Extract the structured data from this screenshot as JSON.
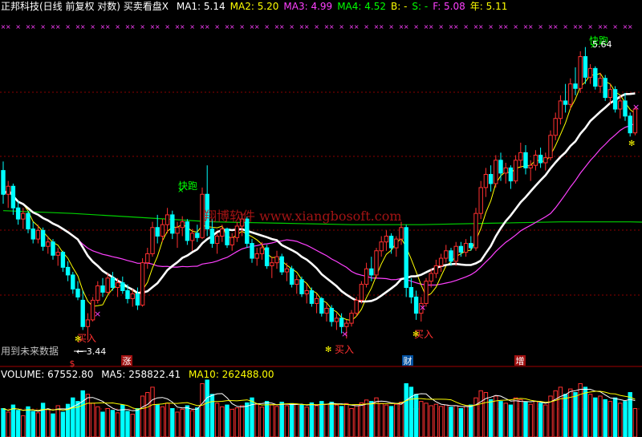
{
  "header": {
    "title": "正邦科技(日线 前复权 对数) 买卖看盘X",
    "indicators": [
      {
        "name": "MA1:",
        "value": "5.14",
        "color": "#ffffff"
      },
      {
        "name": "MA2:",
        "value": "5.20",
        "color": "#ffff00"
      },
      {
        "name": "MA3:",
        "value": "4.99",
        "color": "#ff40ff"
      },
      {
        "name": "MA4:",
        "value": "4.52",
        "color": "#00ff00"
      },
      {
        "name": "B:",
        "value": "-",
        "color": "#ffff00"
      },
      {
        "name": "S:",
        "value": "-",
        "color": "#00ff00"
      },
      {
        "name": "F:",
        "value": "5.08",
        "color": "#ff40ff"
      },
      {
        "name": "年:",
        "value": "5.11",
        "color": "#ffff00"
      }
    ]
  },
  "annotations": {
    "fast_run": "快跑",
    "buy": "买入",
    "peak_price": "5.64",
    "low_price": "3.44",
    "future_data": "用到未来数据",
    "watermark": "翔博软件 www.xiangbosoft.com"
  },
  "markers": {
    "zhang": "涨",
    "cai": "财",
    "zeng": "增",
    "dollar": "$"
  },
  "volume_header": {
    "volume": "VOLUME: 67552.80",
    "ma5": "MA5: 258822.41",
    "ma10": "MA10: 262488.00"
  },
  "colors": {
    "up": "#ff3030",
    "down": "#00ffff",
    "ma_white": "#ffffff",
    "ma_yellow": "#ffff00",
    "ma_magenta": "#ff40ff",
    "ma_green": "#00d000",
    "grid": "#8b0000"
  },
  "chart_data": {
    "type": "candlestick",
    "y_scale": "log",
    "ylim": [
      3.3,
      5.8
    ],
    "series": [
      {
        "name": "MA1",
        "value": 5.14
      },
      {
        "name": "MA2",
        "value": 5.2
      },
      {
        "name": "MA3",
        "value": 4.99
      },
      {
        "name": "MA4",
        "value": 4.52
      }
    ],
    "ohlc": [
      [
        4.58,
        4.65,
        4.33,
        4.4
      ],
      [
        4.4,
        4.5,
        4.3,
        4.46
      ],
      [
        4.46,
        4.48,
        4.25,
        4.3
      ],
      [
        4.3,
        4.35,
        4.18,
        4.22
      ],
      [
        4.22,
        4.3,
        4.15,
        4.26
      ],
      [
        4.26,
        4.28,
        4.12,
        4.15
      ],
      [
        4.15,
        4.2,
        4.05,
        4.08
      ],
      [
        4.08,
        4.18,
        4.05,
        4.14
      ],
      [
        4.14,
        4.16,
        4.0,
        4.03
      ],
      [
        4.03,
        4.1,
        3.98,
        4.06
      ],
      [
        4.06,
        4.08,
        3.94,
        3.97
      ],
      [
        3.97,
        4.02,
        3.9,
        3.99
      ],
      [
        3.99,
        4.0,
        3.86,
        3.89
      ],
      [
        3.89,
        3.93,
        3.8,
        3.84
      ],
      [
        3.84,
        3.86,
        3.72,
        3.75
      ],
      [
        3.75,
        3.8,
        3.68,
        3.7
      ],
      [
        3.68,
        3.74,
        3.5,
        3.52
      ],
      [
        3.52,
        3.6,
        3.44,
        3.56
      ],
      [
        3.56,
        3.7,
        3.55,
        3.68
      ],
      [
        3.68,
        3.8,
        3.66,
        3.77
      ],
      [
        3.77,
        3.82,
        3.7,
        3.73
      ],
      [
        3.73,
        3.85,
        3.72,
        3.82
      ],
      [
        3.82,
        3.86,
        3.74,
        3.76
      ],
      [
        3.76,
        3.82,
        3.7,
        3.79
      ],
      [
        3.79,
        3.83,
        3.72,
        3.74
      ],
      [
        3.74,
        3.78,
        3.66,
        3.69
      ],
      [
        3.69,
        3.75,
        3.64,
        3.72
      ],
      [
        3.72,
        3.76,
        3.62,
        3.65
      ],
      [
        3.65,
        3.95,
        3.64,
        3.92
      ],
      [
        3.92,
        4.02,
        3.88,
        3.98
      ],
      [
        3.98,
        4.2,
        3.96,
        4.16
      ],
      [
        4.16,
        4.25,
        4.05,
        4.1
      ],
      [
        4.1,
        4.22,
        4.06,
        4.18
      ],
      [
        4.18,
        4.3,
        4.12,
        4.25
      ],
      [
        4.25,
        4.28,
        4.08,
        4.12
      ],
      [
        4.12,
        4.2,
        4.02,
        4.16
      ],
      [
        4.16,
        4.24,
        4.1,
        4.2
      ],
      [
        4.2,
        4.22,
        4.04,
        4.07
      ],
      [
        4.07,
        4.15,
        4.0,
        4.12
      ],
      [
        4.12,
        4.18,
        4.06,
        4.09
      ],
      [
        4.09,
        4.45,
        4.08,
        4.4
      ],
      [
        4.4,
        4.62,
        4.1,
        4.15
      ],
      [
        4.15,
        4.22,
        4.02,
        4.05
      ],
      [
        4.05,
        4.12,
        3.98,
        4.1
      ],
      [
        4.1,
        4.18,
        4.06,
        4.15
      ],
      [
        4.15,
        4.16,
        4.02,
        4.04
      ],
      [
        4.04,
        4.12,
        4.0,
        4.09
      ],
      [
        4.09,
        4.2,
        4.06,
        4.17
      ],
      [
        4.17,
        4.26,
        4.1,
        4.22
      ],
      [
        4.22,
        4.24,
        4.02,
        4.05
      ],
      [
        4.05,
        4.08,
        3.92,
        3.95
      ],
      [
        3.95,
        4.02,
        3.9,
        3.98
      ],
      [
        3.98,
        4.06,
        3.94,
        4.02
      ],
      [
        4.02,
        4.04,
        3.88,
        3.9
      ],
      [
        3.9,
        3.96,
        3.82,
        3.92
      ],
      [
        3.92,
        4.0,
        3.88,
        3.96
      ],
      [
        3.96,
        3.98,
        3.84,
        3.86
      ],
      [
        3.86,
        3.92,
        3.8,
        3.88
      ],
      [
        3.88,
        3.9,
        3.76,
        3.78
      ],
      [
        3.78,
        3.84,
        3.72,
        3.81
      ],
      [
        3.81,
        3.83,
        3.7,
        3.72
      ],
      [
        3.72,
        3.78,
        3.66,
        3.74
      ],
      [
        3.74,
        3.76,
        3.64,
        3.66
      ],
      [
        3.66,
        3.72,
        3.6,
        3.69
      ],
      [
        3.69,
        3.7,
        3.58,
        3.6
      ],
      [
        3.6,
        3.66,
        3.55,
        3.63
      ],
      [
        3.63,
        3.65,
        3.52,
        3.55
      ],
      [
        3.55,
        3.6,
        3.5,
        3.57
      ],
      [
        3.57,
        3.6,
        3.48,
        3.52
      ],
      [
        3.52,
        3.56,
        3.45,
        3.54
      ],
      [
        3.54,
        3.62,
        3.52,
        3.6
      ],
      [
        3.6,
        3.7,
        3.58,
        3.68
      ],
      [
        3.68,
        3.8,
        3.66,
        3.78
      ],
      [
        3.78,
        3.92,
        3.76,
        3.88
      ],
      [
        3.88,
        3.96,
        3.8,
        3.84
      ],
      [
        3.84,
        4.02,
        3.82,
        4.0
      ],
      [
        4.0,
        4.1,
        3.96,
        4.06
      ],
      [
        4.06,
        4.14,
        4.0,
        4.1
      ],
      [
        4.1,
        4.12,
        3.98,
        4.02
      ],
      [
        4.02,
        4.1,
        3.96,
        4.08
      ],
      [
        4.08,
        4.2,
        4.04,
        4.16
      ],
      [
        4.16,
        4.18,
        3.7,
        3.76
      ],
      [
        3.76,
        3.82,
        3.66,
        3.7
      ],
      [
        3.7,
        3.74,
        3.56,
        3.6
      ],
      [
        3.6,
        3.7,
        3.55,
        3.66
      ],
      [
        3.66,
        3.82,
        3.64,
        3.8
      ],
      [
        3.8,
        3.88,
        3.76,
        3.85
      ],
      [
        3.85,
        3.94,
        3.82,
        3.9
      ],
      [
        3.9,
        3.98,
        3.86,
        3.95
      ],
      [
        3.95,
        4.04,
        3.92,
        4.0
      ],
      [
        4.0,
        4.02,
        3.9,
        3.93
      ],
      [
        3.93,
        4.06,
        3.9,
        4.03
      ],
      [
        4.03,
        4.06,
        3.96,
        3.99
      ],
      [
        3.99,
        4.08,
        3.96,
        4.05
      ],
      [
        4.05,
        4.1,
        4.0,
        4.02
      ],
      [
        4.02,
        4.3,
        4.0,
        4.26
      ],
      [
        4.26,
        4.5,
        4.22,
        4.45
      ],
      [
        4.45,
        4.6,
        4.38,
        4.55
      ],
      [
        4.55,
        4.62,
        4.42,
        4.48
      ],
      [
        4.48,
        4.7,
        4.45,
        4.66
      ],
      [
        4.66,
        4.72,
        4.5,
        4.56
      ],
      [
        4.56,
        4.64,
        4.48,
        4.6
      ],
      [
        4.6,
        4.62,
        4.44,
        4.5
      ],
      [
        4.5,
        4.7,
        4.48,
        4.66
      ],
      [
        4.66,
        4.8,
        4.6,
        4.72
      ],
      [
        4.72,
        4.78,
        4.55,
        4.6
      ],
      [
        4.6,
        4.66,
        4.5,
        4.62
      ],
      [
        4.62,
        4.74,
        4.58,
        4.7
      ],
      [
        4.7,
        4.76,
        4.6,
        4.64
      ],
      [
        4.64,
        4.72,
        4.58,
        4.68
      ],
      [
        4.68,
        4.9,
        4.66,
        4.86
      ],
      [
        4.86,
        5.05,
        4.82,
        5.0
      ],
      [
        5.0,
        5.2,
        4.95,
        5.15
      ],
      [
        5.15,
        5.3,
        5.05,
        5.12
      ],
      [
        5.12,
        5.35,
        5.08,
        5.3
      ],
      [
        5.3,
        5.45,
        5.2,
        5.26
      ],
      [
        5.26,
        5.6,
        5.22,
        5.55
      ],
      [
        5.55,
        5.64,
        5.3,
        5.36
      ],
      [
        5.36,
        5.48,
        5.3,
        5.44
      ],
      [
        5.44,
        5.46,
        5.25,
        5.28
      ],
      [
        5.28,
        5.4,
        5.22,
        5.35
      ],
      [
        5.35,
        5.38,
        5.15,
        5.18
      ],
      [
        5.18,
        5.3,
        5.12,
        5.25
      ],
      [
        5.25,
        5.28,
        5.05,
        5.08
      ],
      [
        5.08,
        5.2,
        5.0,
        5.15
      ],
      [
        5.15,
        5.22,
        4.98,
        5.02
      ],
      [
        5.02,
        5.05,
        4.85,
        4.88
      ],
      [
        4.88,
        5.1,
        4.86,
        5.08
      ]
    ],
    "ma4_points": [
      [
        4.28,
        0
      ],
      [
        4.26,
        14
      ],
      [
        4.23,
        28
      ],
      [
        4.2,
        42
      ],
      [
        4.19,
        56
      ],
      [
        4.18,
        70
      ],
      [
        4.18,
        84
      ],
      [
        4.19,
        98
      ],
      [
        4.2,
        112
      ],
      [
        4.2,
        126
      ],
      [
        4.19,
        140
      ],
      [
        4.17,
        154
      ],
      [
        4.14,
        168
      ],
      [
        4.12,
        182
      ],
      [
        4.11,
        196
      ],
      [
        4.13,
        210
      ],
      [
        4.2,
        224
      ],
      [
        4.3,
        238
      ],
      [
        4.45,
        252
      ],
      [
        4.52,
        260
      ]
    ],
    "volume": [
      80,
      70,
      90,
      75,
      60,
      85,
      72,
      68,
      95,
      78,
      65,
      88,
      70,
      92,
      110,
      100,
      130,
      120,
      95,
      85,
      70,
      80,
      75,
      68,
      90,
      72,
      64,
      80,
      115,
      125,
      140,
      90,
      85,
      95,
      80,
      70,
      78,
      88,
      74,
      82,
      150,
      160,
      120,
      95,
      85,
      90,
      78,
      82,
      88,
      96,
      110,
      92,
      84,
      100,
      90,
      86,
      98,
      88,
      94,
      92,
      90,
      84,
      96,
      88,
      100,
      92,
      98,
      90,
      86,
      94,
      80,
      88,
      96,
      104,
      100,
      110,
      94,
      90,
      86,
      92,
      98,
      150,
      140,
      120,
      100,
      95,
      88,
      92,
      86,
      90,
      84,
      88,
      80,
      86,
      90,
      110,
      130,
      125,
      105,
      115,
      100,
      95,
      90,
      110,
      105,
      98,
      92,
      100,
      95,
      90,
      115,
      130,
      140,
      120,
      135,
      125,
      150,
      140,
      120,
      110,
      115,
      105,
      100,
      110,
      95,
      100,
      125,
      80
    ],
    "volume_ma5": 258822.41,
    "volume_ma10": 262488.0,
    "volume_last": 67552.8
  }
}
